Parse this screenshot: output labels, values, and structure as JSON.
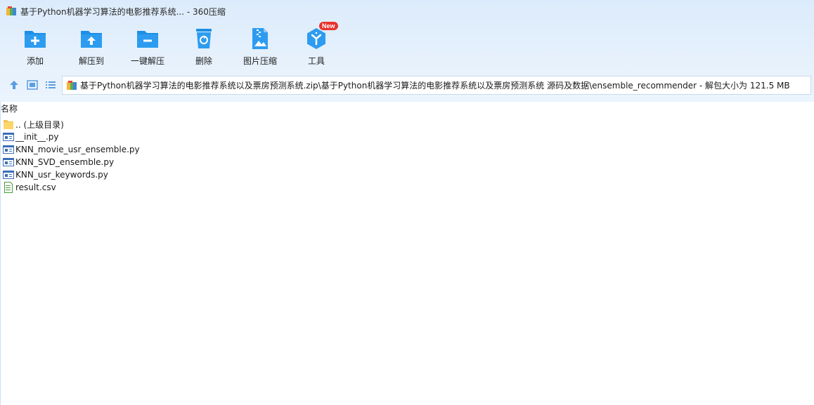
{
  "window": {
    "title": "基于Python机器学习算法的电影推荐系统... - 360压缩"
  },
  "toolbar": {
    "items": [
      {
        "label": "添加",
        "icon": "folder-add-icon"
      },
      {
        "label": "解压到",
        "icon": "folder-extract-icon"
      },
      {
        "label": "一键解压",
        "icon": "one-click-extract-icon"
      },
      {
        "label": "删除",
        "icon": "recycle-bin-icon"
      },
      {
        "label": "图片压缩",
        "icon": "image-compress-icon"
      },
      {
        "label": "工具",
        "icon": "tools-icon",
        "badge": "New"
      }
    ]
  },
  "address": {
    "path": "基于Python机器学习算法的电影推荐系统以及票房预测系统.zip\\基于Python机器学习算法的电影推荐系统以及票房预测系统 源码及数据\\ensemble_recommender - 解包大小为 121.5 MB"
  },
  "columns": {
    "name": "名称"
  },
  "files": [
    {
      "name": ".. (上级目录)",
      "type": "parent-folder"
    },
    {
      "name": "__init__.py",
      "type": "python"
    },
    {
      "name": "KNN_movie_usr_ensemble.py",
      "type": "python"
    },
    {
      "name": "KNN_SVD_ensemble.py",
      "type": "python"
    },
    {
      "name": "KNN_usr_keywords.py",
      "type": "python"
    },
    {
      "name": "result.csv",
      "type": "csv"
    }
  ],
  "colors": {
    "accent": "#1e8fe6",
    "toolbar_bg": "#e3effb",
    "badge": "#e8322e"
  }
}
